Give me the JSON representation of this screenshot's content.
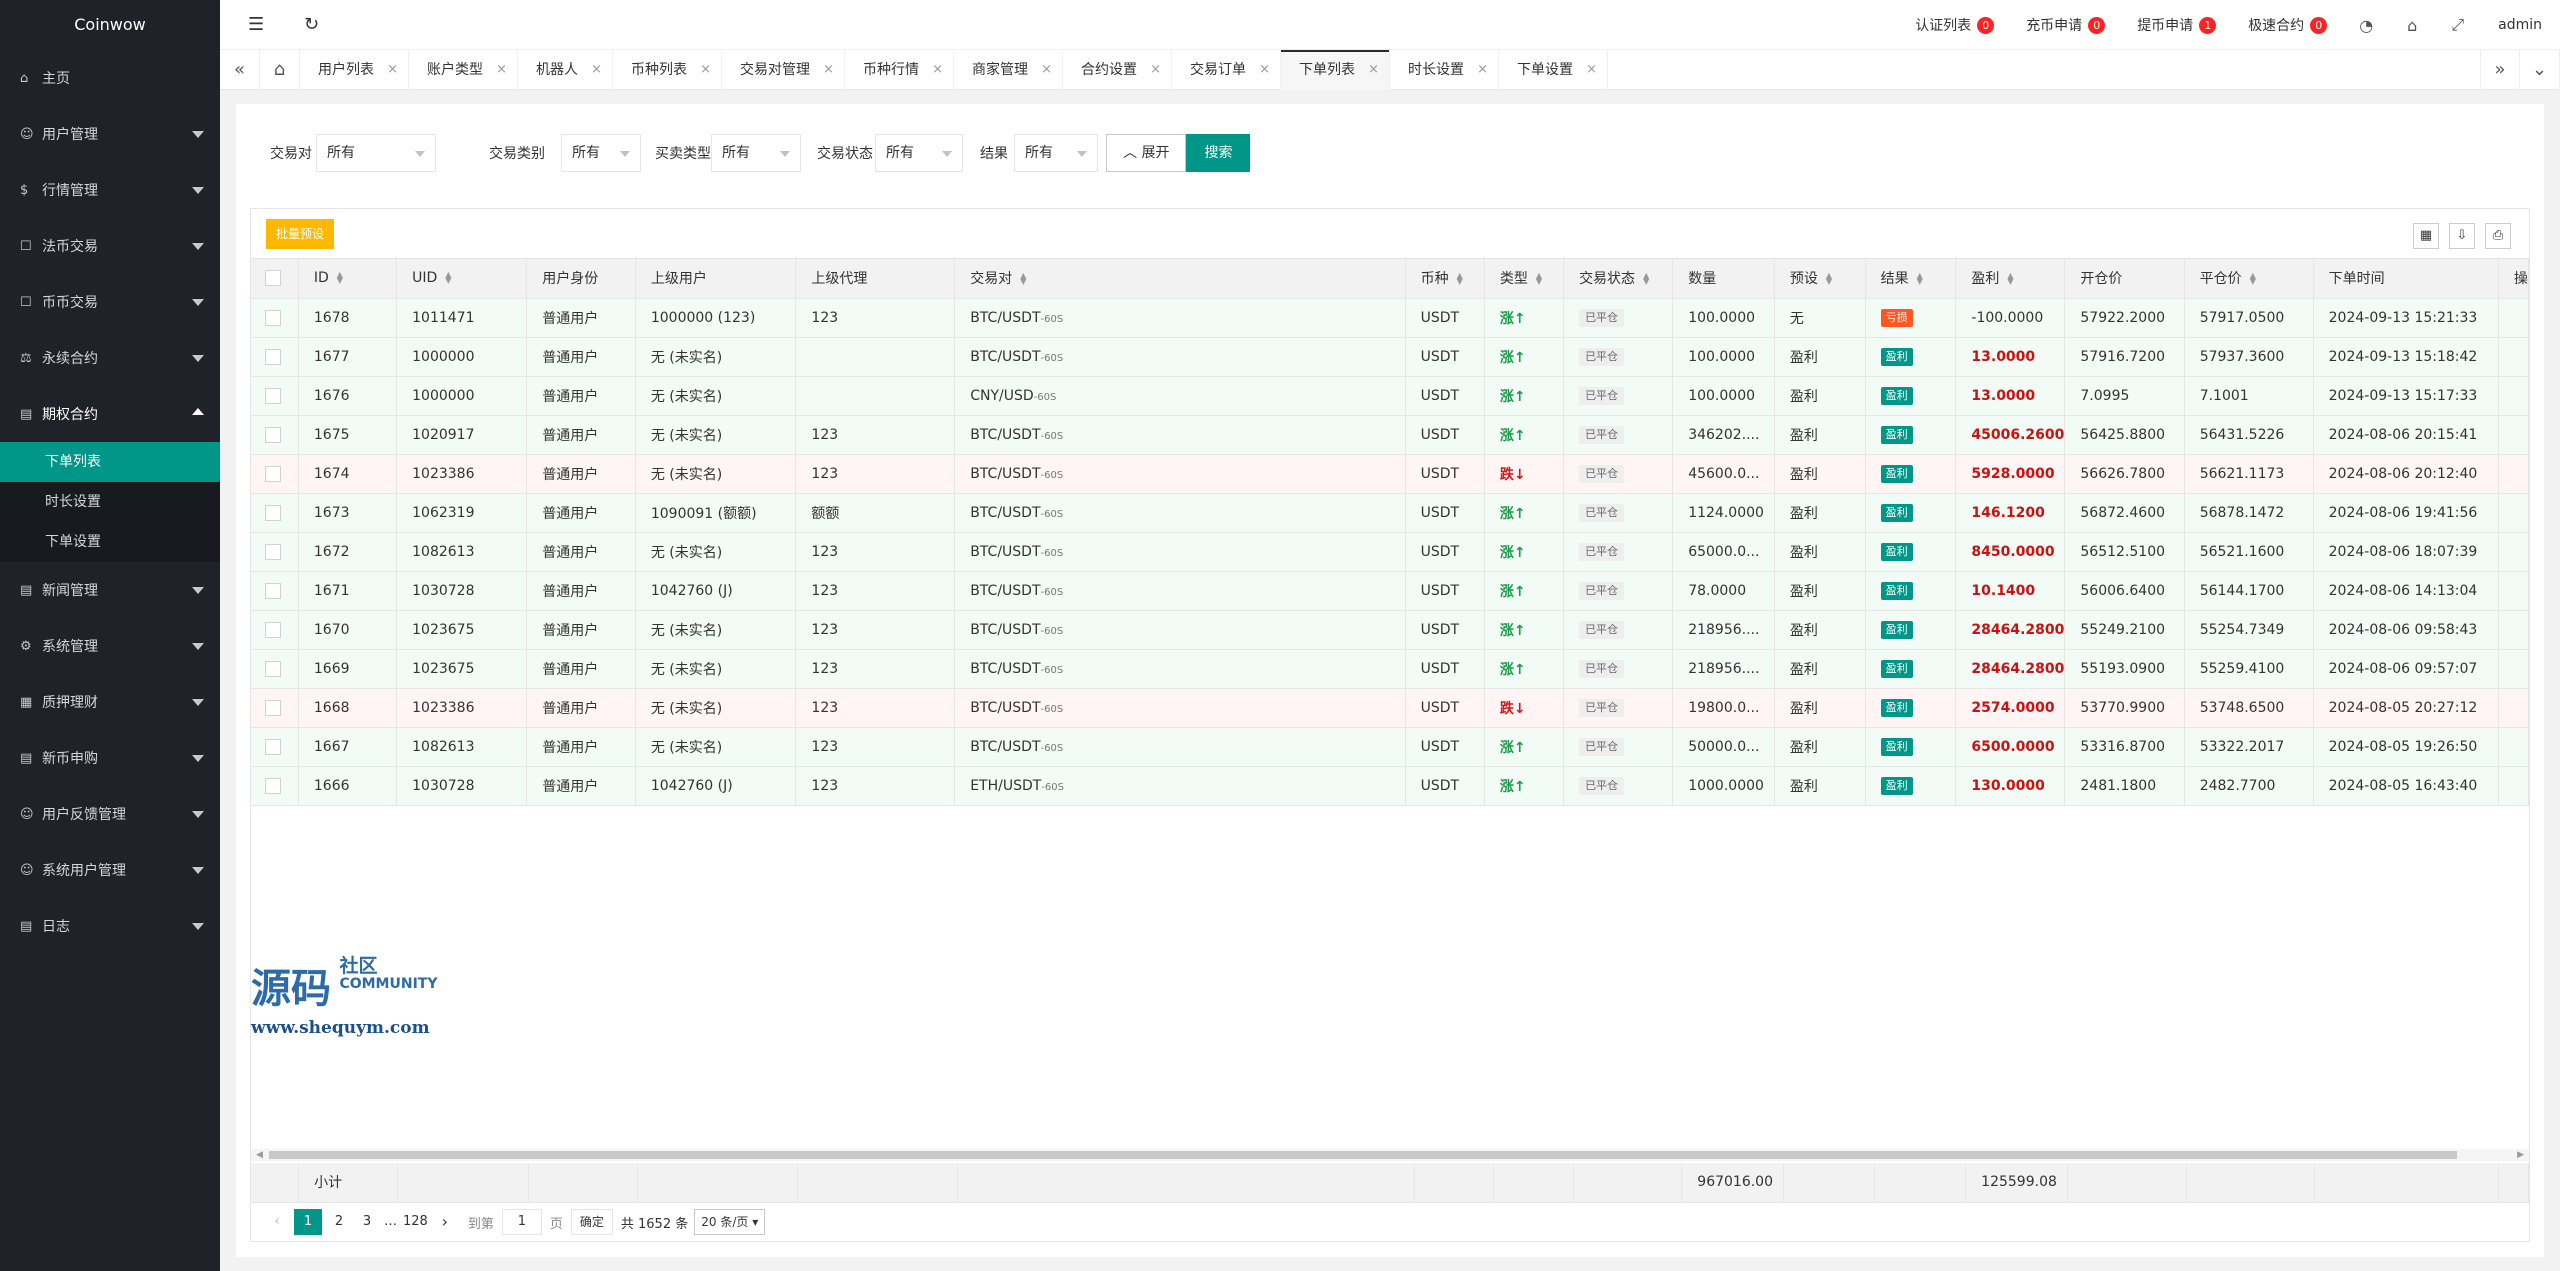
{
  "app": {
    "logo": "Coinwow"
  },
  "sidebar": {
    "items": [
      {
        "icon": "⌂",
        "label": "主页",
        "arrow": false
      },
      {
        "icon": "☺",
        "label": "用户管理",
        "arrow": true
      },
      {
        "icon": "$",
        "label": "行情管理",
        "arrow": true
      },
      {
        "icon": "☐",
        "label": "法币交易",
        "arrow": true
      },
      {
        "icon": "☐",
        "label": "币币交易",
        "arrow": true
      },
      {
        "icon": "⚖",
        "label": "永续合约",
        "arrow": true
      }
    ],
    "open_item": {
      "icon": "▤",
      "label": "期权合约"
    },
    "sub_items": [
      {
        "label": "下单列表",
        "active": true
      },
      {
        "label": "时长设置",
        "active": false
      },
      {
        "label": "下单设置",
        "active": false
      }
    ],
    "items_after": [
      {
        "icon": "▤",
        "label": "新闻管理"
      },
      {
        "icon": "⚙",
        "label": "系统管理"
      },
      {
        "icon": "▦",
        "label": "质押理财"
      },
      {
        "icon": "▤",
        "label": "新币申购"
      },
      {
        "icon": "☺",
        "label": "用户反馈管理"
      },
      {
        "icon": "☺",
        "label": "系统用户管理"
      },
      {
        "icon": "▤",
        "label": "日志"
      }
    ]
  },
  "header": {
    "links": [
      {
        "label": "认证列表",
        "badge": "0"
      },
      {
        "label": "充币申请",
        "badge": "0"
      },
      {
        "label": "提币申请",
        "badge": "1"
      },
      {
        "label": "极速合约",
        "badge": "0"
      }
    ],
    "user": "admin"
  },
  "tabs": [
    {
      "label": "用户列表",
      "active": false
    },
    {
      "label": "账户类型",
      "active": false
    },
    {
      "label": "机器人",
      "active": false
    },
    {
      "label": "币种列表",
      "active": false
    },
    {
      "label": "交易对管理",
      "active": false
    },
    {
      "label": "币种行情",
      "active": false
    },
    {
      "label": "商家管理",
      "active": false
    },
    {
      "label": "合约设置",
      "active": false
    },
    {
      "label": "交易订单",
      "active": false
    },
    {
      "label": "下单列表",
      "active": true
    },
    {
      "label": "时长设置",
      "active": false
    },
    {
      "label": "下单设置",
      "active": false
    }
  ],
  "filters": {
    "pair_label": "交易对",
    "pair_value": "所有",
    "category_label": "交易类别",
    "category_value": "所有",
    "side_label": "买卖类型",
    "side_value": "所有",
    "status_label": "交易状态",
    "status_value": "所有",
    "result_label": "结果",
    "result_value": "所有",
    "expand_label": "展开",
    "search_label": "搜索"
  },
  "toolbar": {
    "batch_label": "批量预设"
  },
  "table": {
    "columns": [
      "ID",
      "UID",
      "用户身份",
      "上级用户",
      "上级代理",
      "交易对",
      "币种",
      "类型",
      "交易状态",
      "数量",
      "预设",
      "结果",
      "盈利",
      "开仓价",
      "平仓价",
      "下单时间",
      "操"
    ],
    "rows": [
      {
        "id": "1678",
        "uid": "1011471",
        "identity": "普通用户",
        "parent_user": "1000000 (123)",
        "parent_agent": "123",
        "pair": "BTC/USDT",
        "pair_suffix": "-60S",
        "coin": "USDT",
        "type": "涨↑",
        "dir": "up",
        "status": "已平仓",
        "qty": "100.0000",
        "preset": "无",
        "result": "亏损",
        "result_kind": "loss",
        "profit": "-100.0000",
        "open": "57922.2000",
        "close": "57917.0500",
        "time": "2024-09-13 15:21:33"
      },
      {
        "id": "1677",
        "uid": "1000000",
        "identity": "普通用户",
        "parent_user": "无 (未实名)",
        "parent_agent": "",
        "pair": "BTC/USDT",
        "pair_suffix": "-60S",
        "coin": "USDT",
        "type": "涨↑",
        "dir": "up",
        "status": "已平仓",
        "qty": "100.0000",
        "preset": "盈利",
        "result": "盈利",
        "result_kind": "win",
        "profit": "13.0000",
        "open": "57916.7200",
        "close": "57937.3600",
        "time": "2024-09-13 15:18:42"
      },
      {
        "id": "1676",
        "uid": "1000000",
        "identity": "普通用户",
        "parent_user": "无 (未实名)",
        "parent_agent": "",
        "pair": "CNY/USD",
        "pair_suffix": "-60S",
        "coin": "USDT",
        "type": "涨↑",
        "dir": "up",
        "status": "已平仓",
        "qty": "100.0000",
        "preset": "盈利",
        "result": "盈利",
        "result_kind": "win",
        "profit": "13.0000",
        "open": "7.0995",
        "close": "7.1001",
        "time": "2024-09-13 15:17:33"
      },
      {
        "id": "1675",
        "uid": "1020917",
        "identity": "普通用户",
        "parent_user": "无 (未实名)",
        "parent_agent": "123",
        "pair": "BTC/USDT",
        "pair_suffix": "-60S",
        "coin": "USDT",
        "type": "涨↑",
        "dir": "up",
        "status": "已平仓",
        "qty": "346202....",
        "preset": "盈利",
        "result": "盈利",
        "result_kind": "win",
        "profit": "45006.2600",
        "open": "56425.8800",
        "close": "56431.5226",
        "time": "2024-08-06 20:15:41"
      },
      {
        "id": "1674",
        "uid": "1023386",
        "identity": "普通用户",
        "parent_user": "无 (未实名)",
        "parent_agent": "123",
        "pair": "BTC/USDT",
        "pair_suffix": "-60S",
        "coin": "USDT",
        "type": "跌↓",
        "dir": "down",
        "status": "已平仓",
        "qty": "45600.0...",
        "preset": "盈利",
        "result": "盈利",
        "result_kind": "win",
        "profit": "5928.0000",
        "open": "56626.7800",
        "close": "56621.1173",
        "time": "2024-08-06 20:12:40"
      },
      {
        "id": "1673",
        "uid": "1062319",
        "identity": "普通用户",
        "parent_user": "1090091 (额额)",
        "parent_agent": "额额",
        "pair": "BTC/USDT",
        "pair_suffix": "-60S",
        "coin": "USDT",
        "type": "涨↑",
        "dir": "up",
        "status": "已平仓",
        "qty": "1124.0000",
        "preset": "盈利",
        "result": "盈利",
        "result_kind": "win",
        "profit": "146.1200",
        "open": "56872.4600",
        "close": "56878.1472",
        "time": "2024-08-06 19:41:56"
      },
      {
        "id": "1672",
        "uid": "1082613",
        "identity": "普通用户",
        "parent_user": "无 (未实名)",
        "parent_agent": "123",
        "pair": "BTC/USDT",
        "pair_suffix": "-60S",
        "coin": "USDT",
        "type": "涨↑",
        "dir": "up",
        "status": "已平仓",
        "qty": "65000.0...",
        "preset": "盈利",
        "result": "盈利",
        "result_kind": "win",
        "profit": "8450.0000",
        "open": "56512.5100",
        "close": "56521.1600",
        "time": "2024-08-06 18:07:39"
      },
      {
        "id": "1671",
        "uid": "1030728",
        "identity": "普通用户",
        "parent_user": "1042760 (J)",
        "parent_agent": "123",
        "pair": "BTC/USDT",
        "pair_suffix": "-60S",
        "coin": "USDT",
        "type": "涨↑",
        "dir": "up",
        "status": "已平仓",
        "qty": "78.0000",
        "preset": "盈利",
        "result": "盈利",
        "result_kind": "win",
        "profit": "10.1400",
        "open": "56006.6400",
        "close": "56144.1700",
        "time": "2024-08-06 14:13:04"
      },
      {
        "id": "1670",
        "uid": "1023675",
        "identity": "普通用户",
        "parent_user": "无 (未实名)",
        "parent_agent": "123",
        "pair": "BTC/USDT",
        "pair_suffix": "-60S",
        "coin": "USDT",
        "type": "涨↑",
        "dir": "up",
        "status": "已平仓",
        "qty": "218956....",
        "preset": "盈利",
        "result": "盈利",
        "result_kind": "win",
        "profit": "28464.2800",
        "open": "55249.2100",
        "close": "55254.7349",
        "time": "2024-08-06 09:58:43"
      },
      {
        "id": "1669",
        "uid": "1023675",
        "identity": "普通用户",
        "parent_user": "无 (未实名)",
        "parent_agent": "123",
        "pair": "BTC/USDT",
        "pair_suffix": "-60S",
        "coin": "USDT",
        "type": "涨↑",
        "dir": "up",
        "status": "已平仓",
        "qty": "218956....",
        "preset": "盈利",
        "result": "盈利",
        "result_kind": "win",
        "profit": "28464.2800",
        "open": "55193.0900",
        "close": "55259.4100",
        "time": "2024-08-06 09:57:07"
      },
      {
        "id": "1668",
        "uid": "1023386",
        "identity": "普通用户",
        "parent_user": "无 (未实名)",
        "parent_agent": "123",
        "pair": "BTC/USDT",
        "pair_suffix": "-60S",
        "coin": "USDT",
        "type": "跌↓",
        "dir": "down",
        "status": "已平仓",
        "qty": "19800.0...",
        "preset": "盈利",
        "result": "盈利",
        "result_kind": "win",
        "profit": "2574.0000",
        "open": "53770.9900",
        "close": "53748.6500",
        "time": "2024-08-05 20:27:12"
      },
      {
        "id": "1667",
        "uid": "1082613",
        "identity": "普通用户",
        "parent_user": "无 (未实名)",
        "parent_agent": "123",
        "pair": "BTC/USDT",
        "pair_suffix": "-60S",
        "coin": "USDT",
        "type": "涨↑",
        "dir": "up",
        "status": "已平仓",
        "qty": "50000.0...",
        "preset": "盈利",
        "result": "盈利",
        "result_kind": "win",
        "profit": "6500.0000",
        "open": "53316.8700",
        "close": "53322.2017",
        "time": "2024-08-05 19:26:50"
      },
      {
        "id": "1666",
        "uid": "1030728",
        "identity": "普通用户",
        "parent_user": "1042760 (J)",
        "parent_agent": "123",
        "pair": "ETH/USDT",
        "pair_suffix": "-60S",
        "coin": "USDT",
        "type": "涨↑",
        "dir": "up",
        "status": "已平仓",
        "qty": "1000.0000",
        "preset": "盈利",
        "result": "盈利",
        "result_kind": "win",
        "profit": "130.0000",
        "open": "2481.1800",
        "close": "2482.7700",
        "time": "2024-08-05 16:43:40"
      }
    ],
    "subtotal": {
      "label": "小计",
      "qty": "967016.00",
      "profit": "125599.08"
    }
  },
  "pager": {
    "prev": "‹",
    "pages": [
      "1",
      "2",
      "3"
    ],
    "ellipsis": "…",
    "last": "128",
    "next": "›",
    "goto_label": "到第",
    "goto_value": "1",
    "page_unit": "页",
    "confirm": "确定",
    "total": "共 1652 条",
    "per_page": "20 条/页"
  },
  "watermark": {
    "big": "源码",
    "cn": "社区",
    "en": "COMMUNITY",
    "url": "www.shequym.com"
  },
  "colors": {
    "accent": "#009688",
    "sidebar": "#20222a",
    "batch": "#ffb800",
    "loss": "#ff5722",
    "badge": "#ff2222"
  }
}
